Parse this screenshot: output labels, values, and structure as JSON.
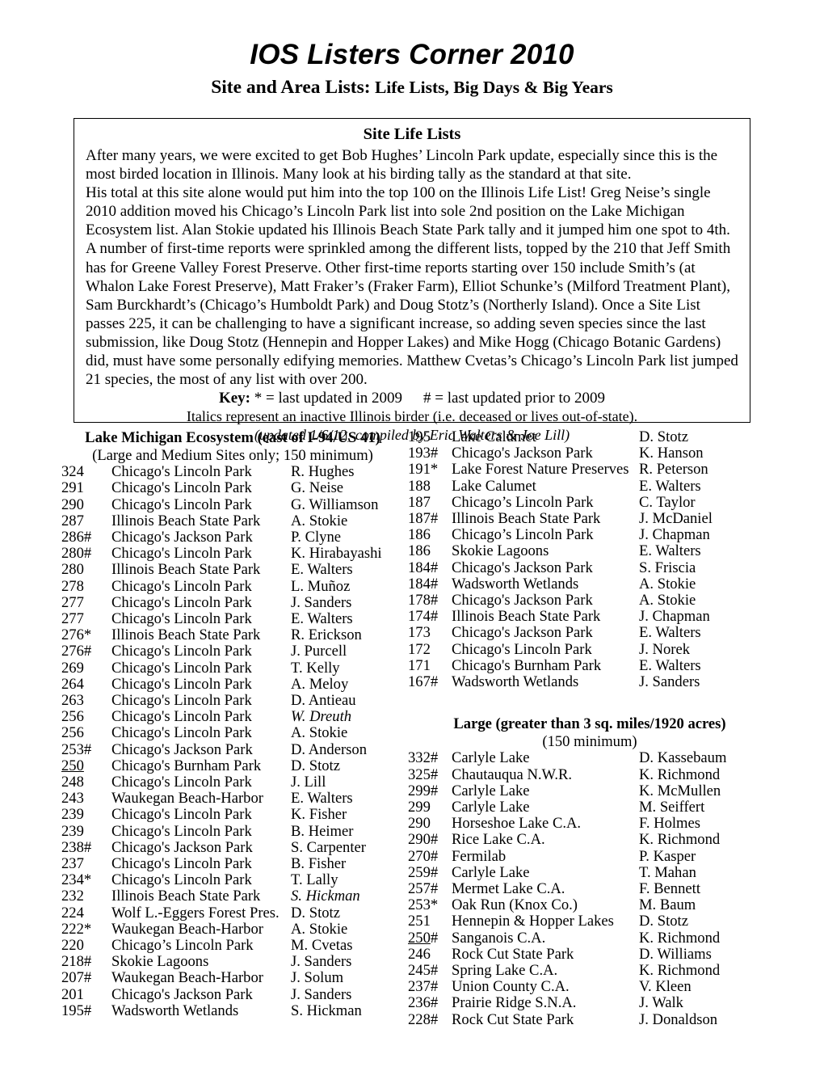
{
  "masthead": {
    "title": "IOS Listers Corner 2010",
    "subtitle_lead": "Site and Area Lists:",
    "subtitle_rest": " Life Lists, Big Days & Big Years"
  },
  "intro": {
    "heading": "Site Life Lists",
    "paragraph1": "After many years, we were excited to get Bob Hughes’ Lincoln Park update, especially since this is the most birded location in Illinois. Many look at his birding tally as the standard at that site.",
    "paragraph2": "His total at this site alone would put him into the top 100 on the Illinois Life List! Greg Neise’s single 2010 addition moved his Chicago’s Lincoln Park list into sole 2nd position on the Lake Michigan Ecosystem list.  Alan Stokie updated his Illinois Beach State Park tally and it jumped him one spot to 4th. A number of first-time reports were sprinkled among the different lists, topped by the 210 that Jeff Smith has for Greene Valley Forest Preserve.  Other first-time reports starting over 150 include Smith’s (at Whalon Lake Forest Preserve),  Matt Fraker’s (Fraker Farm), Elliot Schunke’s (Milford Treatment Plant), Sam Burckhardt’s (Chicago’s Humboldt Park) and Doug Stotz’s (Northerly Island). Once a Site List passes 225, it can be challenging to have a significant increase, so adding seven species since the last submission, like Doug Stotz (Hennepin and Hopper Lakes) and Mike Hogg (Chicago Botanic Gardens) did, must have some personally edifying memories. Matthew Cvetas’s Chicago’s Lincoln Park list jumped 21 species, the most of any list with over 200.",
    "key_label": "Key:",
    "key_star": " * = last updated in 2009",
    "key_hash": "# = last updated prior to 2009",
    "italics_note": "Italics represent an inactive Illinois birder (i.e. deceased or lives out-of-state).",
    "updated_note": "(updated 1/6/12; compiled by Eric Walters & Joe Lill)"
  },
  "sections": {
    "lake_michigan": {
      "title": "Lake Michigan Ecosystem (east of I-94/US 41)",
      "subtitle": "(Large and Medium Sites only; 150 minimum)",
      "rows_left": [
        {
          "num": "324",
          "site": "Chicago's Lincoln Park",
          "who": "R. Hughes"
        },
        {
          "num": "291",
          "site": "Chicago's Lincoln Park",
          "who": "G. Neise"
        },
        {
          "num": "290",
          "site": "Chicago's Lincoln Park",
          "who": "G. Williamson"
        },
        {
          "num": "287",
          "site": "Illinois Beach State Park",
          "who": "A. Stokie"
        },
        {
          "num": "286#",
          "site": "Chicago's Jackson Park",
          "who": "P. Clyne"
        },
        {
          "num": "280#",
          "site": "Chicago's Lincoln Park",
          "who": "K. Hirabayashi"
        },
        {
          "num": "280",
          "site": "Illinois Beach State Park",
          "who": "E. Walters"
        },
        {
          "num": "278",
          "site": "Chicago's Lincoln Park",
          "who": "L. Muñoz"
        },
        {
          "num": "277",
          "site": "Chicago's Lincoln Park",
          "who": "J. Sanders"
        },
        {
          "num": "277",
          "site": "Chicago's Lincoln Park",
          "who": "E. Walters"
        },
        {
          "num": "276*",
          "site": "Illinois Beach State Park",
          "who": "R. Erickson"
        },
        {
          "num": "276#",
          "site": "Chicago's Lincoln Park",
          "who": "J. Purcell"
        },
        {
          "num": "269",
          "site": "Chicago's Lincoln Park",
          "who": "T. Kelly"
        },
        {
          "num": "264",
          "site": "Chicago's Lincoln Park",
          "who": "A. Meloy"
        },
        {
          "num": "263",
          "site": "Chicago's Lincoln Park",
          "who": "D. Antieau"
        },
        {
          "num": "256",
          "site": "Chicago's Lincoln Park",
          "who": "W. Dreuth",
          "who_italic": true
        },
        {
          "num": "256",
          "site": "Chicago's Lincoln Park",
          "who": "A. Stokie"
        },
        {
          "num": "253#",
          "site": "Chicago's Jackson Park",
          "who": "D. Anderson"
        },
        {
          "num": "250",
          "site": "Chicago's Burnham Park",
          "who": "D. Stotz",
          "num_underline": true
        },
        {
          "num": "248",
          "site": "Chicago's Lincoln Park",
          "who": "J. Lill"
        },
        {
          "num": "243",
          "site": "Waukegan Beach-Harbor",
          "who": "E. Walters"
        },
        {
          "num": "239",
          "site": "Chicago's Lincoln Park",
          "who": "K. Fisher"
        },
        {
          "num": "239",
          "site": "Chicago's Lincoln Park",
          "who": "B. Heimer"
        },
        {
          "num": "238#",
          "site": "Chicago's Jackson Park",
          "who": "S. Carpenter"
        },
        {
          "num": "237",
          "site": "Chicago's Lincoln Park",
          "who": "B. Fisher"
        },
        {
          "num": "234*",
          "site": "Chicago's Lincoln Park",
          "who": "T. Lally"
        },
        {
          "num": "232",
          "site": "Illinois Beach State Park",
          "who": "S. Hickman",
          "who_italic": true
        },
        {
          "num": "224",
          "site": "Wolf L.-Eggers Forest Pres.",
          "who": "D. Stotz"
        },
        {
          "num": "222*",
          "site": "Waukegan Beach-Harbor",
          "who": "A. Stokie"
        },
        {
          "num": "220",
          "site": "Chicago’s Lincoln Park",
          "who": "M. Cvetas"
        },
        {
          "num": "218#",
          "site": "Skokie Lagoons",
          "who": "J. Sanders"
        },
        {
          "num": "207#",
          "site": "Waukegan Beach-Harbor",
          "who": "J. Solum"
        },
        {
          "num": "201",
          "site": "Chicago's Jackson Park",
          "who": "J. Sanders"
        },
        {
          "num": "195#",
          "site": "Wadsworth Wetlands",
          "who": "S. Hickman"
        }
      ],
      "rows_right": [
        {
          "num": "195",
          "site": "Lake Calumet",
          "who": "D. Stotz"
        },
        {
          "num": "193#",
          "site": "Chicago's Jackson Park",
          "who": "K. Hanson"
        },
        {
          "num": "191*",
          "site": "Lake Forest Nature Preserves",
          "who": "R. Peterson"
        },
        {
          "num": "188",
          "site": "Lake Calumet",
          "who": "E. Walters"
        },
        {
          "num": "187",
          "site": "Chicago’s Lincoln Park",
          "who": "C. Taylor"
        },
        {
          "num": "187#",
          "site": "Illinois Beach State Park",
          "who": "J. McDaniel"
        },
        {
          "num": "186",
          "site": "Chicago’s Lincoln Park",
          "who": "J. Chapman"
        },
        {
          "num": "186",
          "site": "Skokie Lagoons",
          "who": "E. Walters"
        },
        {
          "num": "184#",
          "site": "Chicago's Jackson Park",
          "who": "S. Friscia"
        },
        {
          "num": "184#",
          "site": "Wadsworth Wetlands",
          "who": "A. Stokie"
        },
        {
          "num": "178#",
          "site": "Chicago's Jackson Park",
          "who": "A. Stokie"
        },
        {
          "num": "174#",
          "site": "Illinois Beach State Park",
          "who": "J. Chapman"
        },
        {
          "num": "173",
          "site": "Chicago's Jackson Park",
          "who": "E. Walters"
        },
        {
          "num": "172",
          "site": "Chicago's Lincoln Park",
          "who": "J. Norek"
        },
        {
          "num": "171",
          "site": "Chicago's Burnham Park",
          "who": "E. Walters"
        },
        {
          "num": "167#",
          "site": "Wadsworth Wetlands",
          "who": "J. Sanders"
        }
      ]
    },
    "large": {
      "title": "Large  (greater than 3 sq. miles/1920 acres)",
      "subtitle": "(150 minimum)",
      "rows": [
        {
          "num": "332#",
          "site": "Carlyle Lake",
          "who": "D. Kassebaum"
        },
        {
          "num": "325#",
          "site": "Chautauqua N.W.R.",
          "who": "K. Richmond"
        },
        {
          "num": "299#",
          "site": "Carlyle Lake",
          "who": "K. McMullen"
        },
        {
          "num": "299",
          "site": "Carlyle Lake",
          "who": "M. Seiffert"
        },
        {
          "num": "290",
          "site": "Horseshoe Lake C.A.",
          "who": "F. Holmes"
        },
        {
          "num": "290#",
          "site": "Rice Lake C.A.",
          "who": "K. Richmond"
        },
        {
          "num": "270#",
          "site": "Fermilab",
          "who": "P. Kasper"
        },
        {
          "num": "259#",
          "site": "Carlyle Lake",
          "who": "T. Mahan"
        },
        {
          "num": "257#",
          "site": "Mermet Lake C.A.",
          "who": "F. Bennett"
        },
        {
          "num": "253*",
          "site": "Oak Run (Knox Co.)",
          "who": "M. Baum"
        },
        {
          "num": "251",
          "site": "Hennepin & Hopper Lakes",
          "who": "D. Stotz"
        },
        {
          "num": "250#",
          "site": "Sanganois C.A.",
          "who": "K. Richmond",
          "num_underline_partial": "250"
        },
        {
          "num": "246",
          "site": "Rock Cut State Park",
          "who": "D. Williams"
        },
        {
          "num": "245#",
          "site": "Spring Lake C.A.",
          "who": "K. Richmond"
        },
        {
          "num": "237#",
          "site": "Union County C.A.",
          "who": "V. Kleen"
        },
        {
          "num": "236#",
          "site": "Prairie Ridge S.N.A.",
          "who": "J. Walk"
        },
        {
          "num": "228#",
          "site": "Rock Cut State Park",
          "who": "J. Donaldson"
        }
      ]
    }
  }
}
